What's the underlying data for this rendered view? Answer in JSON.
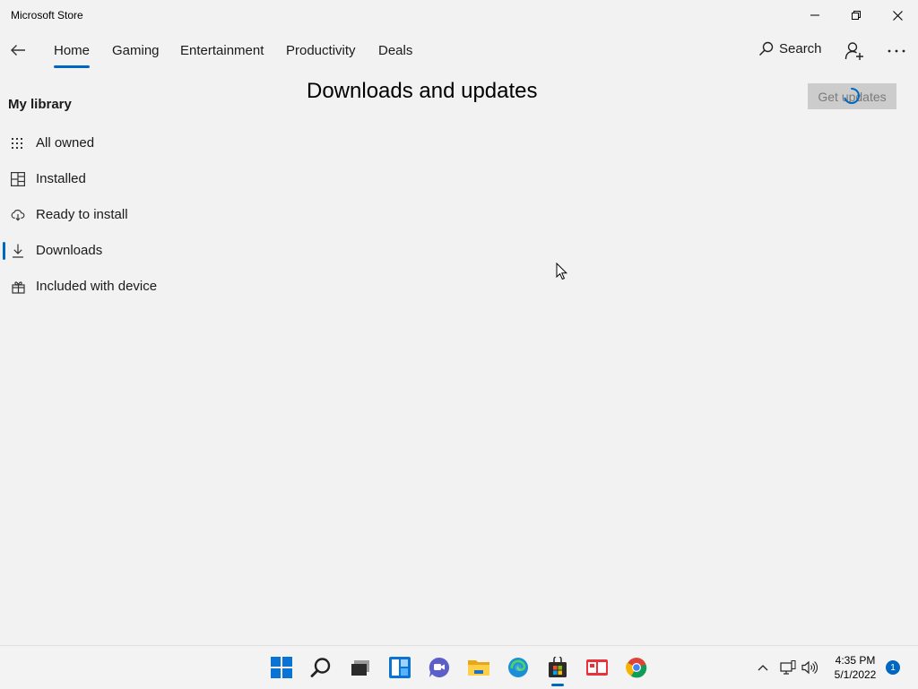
{
  "window": {
    "title": "Microsoft Store",
    "controls": {
      "minimize": "minimize-icon",
      "maximize": "restore-icon",
      "close": "close-icon"
    }
  },
  "nav": {
    "back_icon": "back-arrow-icon",
    "tabs": [
      {
        "label": "Home",
        "active": true
      },
      {
        "label": "Gaming",
        "active": false
      },
      {
        "label": "Entertainment",
        "active": false
      },
      {
        "label": "Productivity",
        "active": false
      },
      {
        "label": "Deals",
        "active": false
      }
    ],
    "search_label": "Search",
    "account_icon": "add-account-icon",
    "more_icon": "more-icon"
  },
  "sidebar": {
    "title": "My library",
    "items": [
      {
        "label": "All owned",
        "icon": "grid-icon",
        "selected": false
      },
      {
        "label": "Installed",
        "icon": "installed-icon",
        "selected": false
      },
      {
        "label": "Ready to install",
        "icon": "cloud-download-icon",
        "selected": false
      },
      {
        "label": "Downloads",
        "icon": "download-icon",
        "selected": true
      },
      {
        "label": "Included with device",
        "icon": "gift-icon",
        "selected": false
      }
    ]
  },
  "main": {
    "title": "Downloads and updates",
    "get_updates_label": "Get updates",
    "get_updates_disabled": true
  },
  "taskbar": {
    "apps": [
      "start-icon",
      "search-icon",
      "task-view-icon",
      "widgets-icon",
      "chat-icon",
      "file-explorer-icon",
      "edge-icon",
      "store-icon",
      "news-icon",
      "chrome-icon"
    ],
    "active_app": "store-icon",
    "tray": [
      "chevron-up-icon",
      "network-icon",
      "volume-icon"
    ],
    "time": "4:35 PM",
    "date": "5/1/2022",
    "notification_count": "1"
  },
  "colors": {
    "accent": "#0067c0",
    "background": "#f2f2f2",
    "button_disabled": "#cccccc"
  }
}
